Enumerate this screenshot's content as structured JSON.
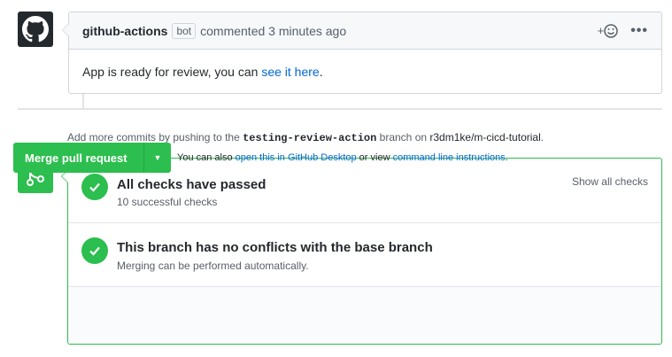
{
  "comment": {
    "author": "github-actions",
    "badge": "bot",
    "action": "commented 3 minutes ago",
    "reaction_label": "+",
    "more_label": "•••",
    "body_prefix": "App is ready for review, you can ",
    "body_link": "see it here",
    "body_suffix": "."
  },
  "hint": {
    "prefix": "Add more commits by pushing to the ",
    "branch": "testing-review-action",
    "middle": " branch on ",
    "repo": "r3dm1ke/m-cicd-tutorial",
    "suffix": "."
  },
  "checks": {
    "title": "All checks have passed",
    "subtitle": "10 successful checks",
    "show_all": "Show all checks"
  },
  "conflicts": {
    "title": "This branch has no conflicts with the base branch",
    "subtitle": "Merging can be performed automatically."
  },
  "merge": {
    "button_label": "Merge pull request",
    "alt_prefix": "You can also ",
    "desktop_link": "open this in GitHub Desktop",
    "alt_middle": " or view ",
    "cli_link": "command line instructions",
    "alt_suffix": "."
  },
  "colors": {
    "success": "#2cbe4e",
    "link": "#0366d6",
    "muted": "#586069"
  },
  "icons": {
    "avatar": "github-octocat-icon",
    "reaction": "smiley-icon",
    "merge": "git-merge-icon",
    "check": "check-icon",
    "caret": "triangle-down-icon"
  }
}
